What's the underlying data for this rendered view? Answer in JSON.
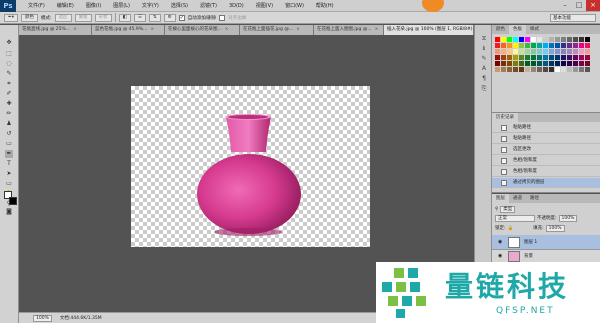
{
  "app": {
    "logo": "Ps"
  },
  "menu": [
    "文件(F)",
    "编辑(E)",
    "图像(I)",
    "图层(L)",
    "文字(Y)",
    "选择(S)",
    "滤镜(T)",
    "3D(D)",
    "视图(V)",
    "窗口(W)",
    "帮助(H)"
  ],
  "workspace": "基本功能",
  "options_bar": {
    "mode": "颜色",
    "opacity_label": "模式:",
    "buttons": [
      "选区",
      "蒙版",
      "形状"
    ],
    "checkbox_label": "自动添加/删除",
    "checkbox2_label": "对齐边缘"
  },
  "tabs": [
    {
      "label": "花瓶直线.jpg @ 25%...",
      "active": false
    },
    {
      "label": "蓝色花瓶.jpg @ 45.9%...",
      "active": false
    },
    {
      "label": "在被心里面被心的花朵图...",
      "active": false
    },
    {
      "label": "在花瓶上面插花.jpg @...",
      "active": false
    },
    {
      "label": "在花瓶上面入图图.jpg @...",
      "active": false
    },
    {
      "label": "插入花朵.jpg @ 100% (图层 1, RGB/8#)",
      "active": true
    }
  ],
  "status": {
    "zoom": "100%",
    "doc": "文档:444.6K/1.35M"
  },
  "swatches_panel": {
    "tabs": [
      "颜色",
      "色板",
      "样式"
    ],
    "active": 1
  },
  "history_panel": {
    "title": "历史记录",
    "items": [
      {
        "label": "粘贴路径",
        "selected": false
      },
      {
        "label": "粘贴路径",
        "selected": false
      },
      {
        "label": "选区更改",
        "selected": false
      },
      {
        "label": "色相/饱和度",
        "selected": false
      },
      {
        "label": "色相/饱和度",
        "selected": false
      },
      {
        "label": "通过拷贝的图层",
        "selected": true
      }
    ]
  },
  "layers_panel": {
    "tabs": [
      "图层",
      "通道",
      "路径"
    ],
    "filter": "类型",
    "blend": "正常",
    "opacity_label": "不透明度:",
    "opacity": "100%",
    "lock_label": "锁定:",
    "fill_label": "填充:",
    "fill": "100%",
    "layers": [
      {
        "name": "图层 1",
        "selected": true
      },
      {
        "name": "背景",
        "selected": false
      }
    ]
  },
  "watermark": {
    "title": "量链科技",
    "sub": "QFSP.NET"
  },
  "colors": {
    "vase": "#d63a8e",
    "accent": "#1fa8a8",
    "selection": "#a8bfe0"
  }
}
